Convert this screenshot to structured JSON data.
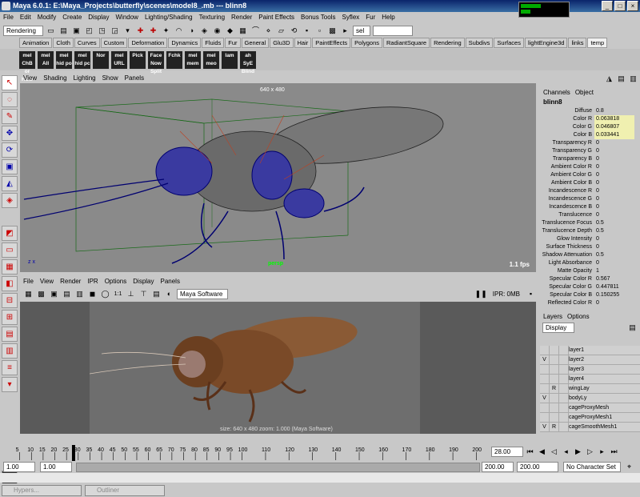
{
  "window": {
    "title": "Maya 6.0.1: E:\\Maya_Projects\\butterfly\\scenes\\model8_.mb   ---   blinn8"
  },
  "menubar": [
    "File",
    "Edit",
    "Modify",
    "Create",
    "Display",
    "Window",
    "Lighting/Shading",
    "Texturing",
    "Render",
    "Paint Effects",
    "Bonus Tools",
    "Syflex",
    "Fur",
    "Help"
  ],
  "mode_dropdown": "Rendering",
  "sel_dropdown": "sel",
  "shelf_tabs": [
    "Animation",
    "Cloth",
    "Curves",
    "Custom",
    "Deformation",
    "Dynamics",
    "Fluids",
    "Fur",
    "General",
    "Glu3D",
    "Hair",
    "PaintEffects",
    "Polygons",
    "RadiantSquare",
    "Rendering",
    "Subdivs",
    "Surfaces",
    "lightEngine3d",
    "links",
    "temp"
  ],
  "active_shelf_tab": "temp",
  "shelf_icons": [
    "mel ChB or HUD",
    "mel All",
    "mel hid po",
    "mel hid pc",
    "Nor",
    "mel URL",
    "Pick",
    "Face Now Split",
    "Fchk",
    "mel mem",
    "mel meo",
    "lam",
    "ah SyE Blind"
  ],
  "viewport1": {
    "menu": [
      "View",
      "Shading",
      "Lighting",
      "Show",
      "Panels"
    ],
    "resolution": "640 x 480",
    "camera": "persp",
    "fps": "1.1 fps"
  },
  "viewport2": {
    "menu": [
      "File",
      "View",
      "Render",
      "IPR",
      "Options",
      "Display",
      "Panels"
    ],
    "renderer": "Maya Software",
    "ipr": "IPR: 0MB",
    "info": "size: 640 x 480 zoom: 1.000     (Maya Software)"
  },
  "channelbox": {
    "tabs": [
      "Channels",
      "Object"
    ],
    "node": "blinn8",
    "attrs": [
      {
        "l": "Diffuse",
        "v": "0.8",
        "hl": false
      },
      {
        "l": "Color R",
        "v": "0.063818",
        "hl": true
      },
      {
        "l": "Color G",
        "v": "0.046807",
        "hl": true
      },
      {
        "l": "Color B",
        "v": "0.033441",
        "hl": true
      },
      {
        "l": "Transparency R",
        "v": "0",
        "hl": false
      },
      {
        "l": "Transparency G",
        "v": "0",
        "hl": false
      },
      {
        "l": "Transparency B",
        "v": "0",
        "hl": false
      },
      {
        "l": "Ambient Color R",
        "v": "0",
        "hl": false
      },
      {
        "l": "Ambient Color G",
        "v": "0",
        "hl": false
      },
      {
        "l": "Ambient Color B",
        "v": "0",
        "hl": false
      },
      {
        "l": "Incandescence R",
        "v": "0",
        "hl": false
      },
      {
        "l": "Incandescence G",
        "v": "0",
        "hl": false
      },
      {
        "l": "Incandescence B",
        "v": "0",
        "hl": false
      },
      {
        "l": "Translucence",
        "v": "0",
        "hl": false
      },
      {
        "l": "Translucence Focus",
        "v": "0.5",
        "hl": false
      },
      {
        "l": "Translucence Depth",
        "v": "0.5",
        "hl": false
      },
      {
        "l": "Glow Intensity",
        "v": "0",
        "hl": false
      },
      {
        "l": "Surface Thickness",
        "v": "0",
        "hl": false
      },
      {
        "l": "Shadow Attenuation",
        "v": "0.5",
        "hl": false
      },
      {
        "l": "Light Absorbance",
        "v": "0",
        "hl": false
      },
      {
        "l": "Matte Opacity",
        "v": "1",
        "hl": false
      },
      {
        "l": "Specular Color R",
        "v": "0.567",
        "hl": false
      },
      {
        "l": "Specular Color G",
        "v": "0.447811",
        "hl": false
      },
      {
        "l": "Specular Color B",
        "v": "0.150255",
        "hl": false
      },
      {
        "l": "Reflected Color R",
        "v": "0",
        "hl": false
      }
    ]
  },
  "layers": {
    "tabs": [
      "Layers",
      "Options"
    ],
    "display": "Display",
    "rows": [
      {
        "v": "",
        "r": "",
        "name": "layer1"
      },
      {
        "v": "V",
        "r": "",
        "name": "layer2"
      },
      {
        "v": "",
        "r": "",
        "name": "layer3"
      },
      {
        "v": "",
        "r": "",
        "name": "layer4"
      },
      {
        "v": "",
        "r": "R",
        "name": "wingLay"
      },
      {
        "v": "V",
        "r": "",
        "name": "bodyLy"
      },
      {
        "v": "",
        "r": "",
        "name": "cageProxyMesh"
      },
      {
        "v": "",
        "r": "",
        "name": "cageProxyMesh1"
      },
      {
        "v": "V",
        "r": "R",
        "name": "cageSmoothMesh1"
      }
    ]
  },
  "timeline": {
    "ticks": [
      "5",
      "10",
      "15",
      "20",
      "25",
      "30",
      "35",
      "40",
      "45",
      "50",
      "55",
      "60",
      "65",
      "70",
      "75",
      "80",
      "85",
      "90",
      "95",
      "100",
      "110",
      "120",
      "130",
      "140",
      "150",
      "160",
      "170",
      "180",
      "190",
      "200"
    ],
    "current": "28.00"
  },
  "range": {
    "start": "1.00",
    "playstart": "1.00",
    "playend": "200.00",
    "end": "200.00",
    "character": "No Character Set"
  },
  "taskbar": [
    "Hypers...",
    "Outliner"
  ]
}
